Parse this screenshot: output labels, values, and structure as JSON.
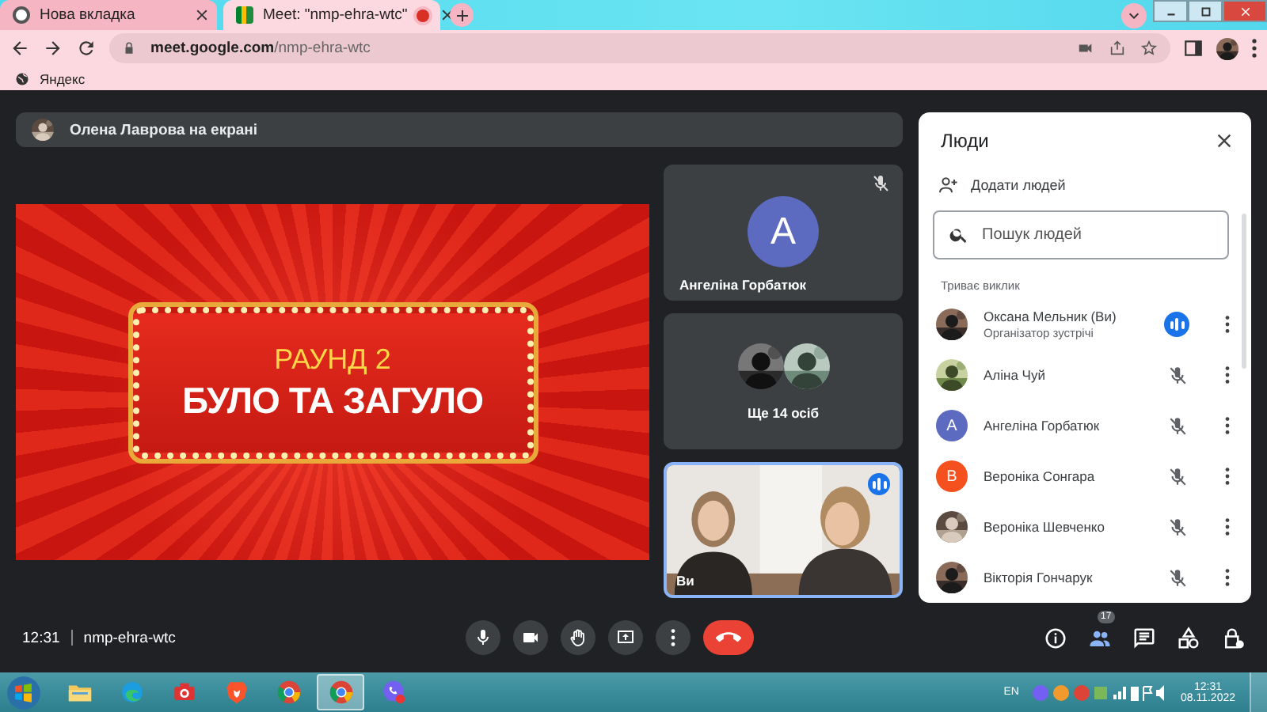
{
  "browser": {
    "tabs": [
      {
        "title": "Нова вкладка",
        "selected": false,
        "recording": false
      },
      {
        "title": "Meet: \"nmp-ehra-wtc\"",
        "selected": true,
        "recording": true
      }
    ],
    "url_host": "meet.google.com",
    "url_path": "/nmp-ehra-wtc",
    "bookmarks": [
      "Яндекс"
    ]
  },
  "meet": {
    "presenter_banner": "Олена Лаврова на екрані",
    "slide": {
      "line_1": "РАУНД 2",
      "line_2": "БУЛО ТА ЗАГУЛО"
    },
    "tiles": [
      {
        "kind": "avatar",
        "initial": "A",
        "name": "Ангеліна Горбатюк",
        "muted": true
      },
      {
        "kind": "group",
        "caption": "Ще 14 осіб"
      },
      {
        "kind": "video",
        "name": "Ви",
        "speaking": true
      }
    ],
    "clock": "12:31",
    "meeting_code": "nmp-ehra-wtc",
    "people_count": "17"
  },
  "people_panel": {
    "title": "Люди",
    "add_people": "Додати людей",
    "search": {
      "placeholder": "Пошук людей"
    },
    "section": "Триває виклик",
    "participants": [
      {
        "name": "Оксана Мельник (Ви)",
        "role": "Організатор зустрічі",
        "speaking": true
      },
      {
        "name": "Аліна Чуй",
        "speaking": false
      },
      {
        "name": "Ангеліна Горбатюк",
        "kind": "letter",
        "initial": "A",
        "color": "#5c6bc0",
        "speaking": false
      },
      {
        "name": "Вероніка Сонгара",
        "kind": "letter",
        "initial": "В",
        "color": "#f4511e",
        "speaking": false
      },
      {
        "name": "Вероніка Шевченко",
        "speaking": false
      },
      {
        "name": "Вікторія Гончарук",
        "speaking": false
      }
    ]
  },
  "taskbar": {
    "apps": [
      {
        "kind": "folder",
        "selected": false
      },
      {
        "kind": "edge",
        "selected": false
      },
      {
        "kind": "camera",
        "selected": false
      },
      {
        "kind": "brave",
        "selected": false
      },
      {
        "kind": "chrome",
        "selected": false
      },
      {
        "kind": "chrome",
        "selected": true
      },
      {
        "kind": "viber",
        "selected": false
      }
    ],
    "language": "EN",
    "time": "12:31",
    "date": "08.11.2022"
  }
}
